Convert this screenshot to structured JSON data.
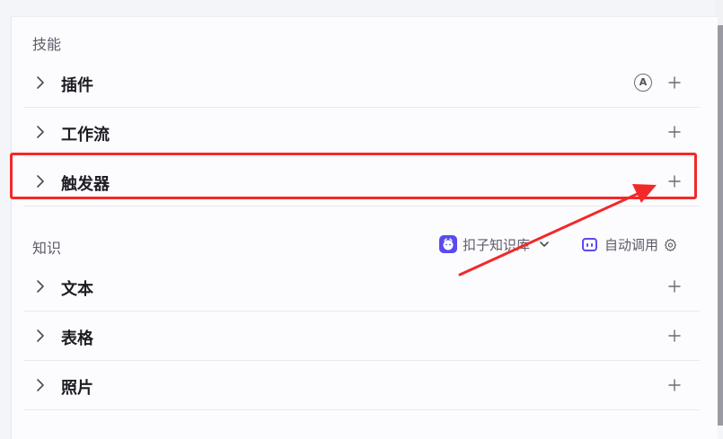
{
  "skills": {
    "title": "技能",
    "items": [
      {
        "label": "插件",
        "badge": "A"
      },
      {
        "label": "工作流"
      },
      {
        "label": "触发器"
      }
    ]
  },
  "knowledge": {
    "title": "知识",
    "kb_selector": "扣子知识库",
    "auto_call": "自动调用",
    "items": [
      {
        "label": "文本"
      },
      {
        "label": "表格"
      },
      {
        "label": "照片"
      }
    ]
  },
  "colors": {
    "highlight": "#f22929",
    "accent": "#5a4af0"
  }
}
